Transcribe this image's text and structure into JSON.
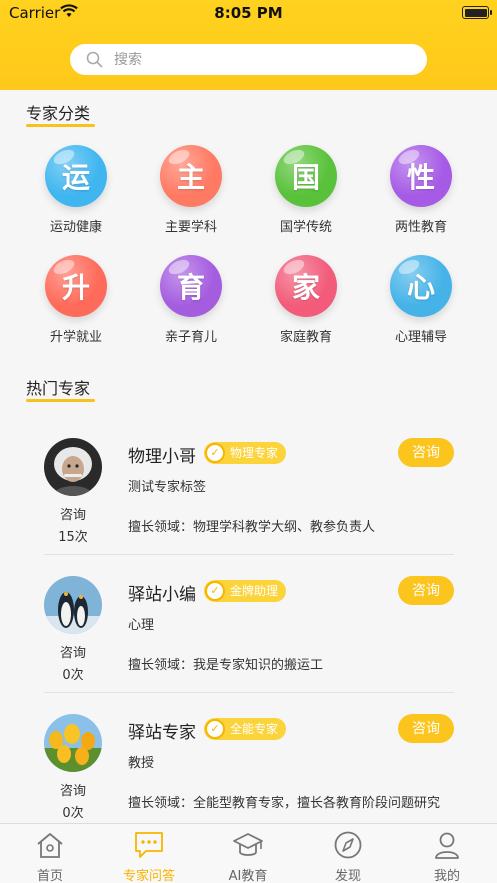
{
  "status_bar": {
    "carrier": "Carrier",
    "time": "8:05 PM"
  },
  "search": {
    "placeholder": "搜索"
  },
  "categories_section": {
    "title": "专家分类",
    "items": [
      {
        "label": "运动健康",
        "glyph": "运",
        "color": "#3fb6f0"
      },
      {
        "label": "主要学科",
        "glyph": "主",
        "color": "#ff7a63"
      },
      {
        "label": "国学传统",
        "glyph": "国",
        "color": "#59c23a"
      },
      {
        "label": "两性教育",
        "glyph": "性",
        "color": "#a65be6"
      },
      {
        "label": "升学就业",
        "glyph": "升",
        "color": "#ff6b5a"
      },
      {
        "label": "亲子育儿",
        "glyph": "育",
        "color": "#a55de0"
      },
      {
        "label": "家庭教育",
        "glyph": "家",
        "color": "#f25c7a"
      },
      {
        "label": "心理辅导",
        "glyph": "心",
        "color": "#45b3e8"
      }
    ]
  },
  "experts_section": {
    "title": "热门专家",
    "experts": [
      {
        "name": "物理小哥",
        "badge": "物理专家",
        "tag": "测试专家标签",
        "field": "擅长领域：物理学科教学大纲、教参负责人",
        "consult_label": "咨询",
        "count": "15次",
        "button": "咨询"
      },
      {
        "name": "驿站小编",
        "badge": "金牌助理",
        "tag": "心理",
        "field": "擅长领域：我是专家知识的搬运工",
        "consult_label": "咨询",
        "count": "0次",
        "button": "咨询"
      },
      {
        "name": "驿站专家",
        "badge": "全能专家",
        "tag": "教授",
        "field": "擅长领域：全能型教育专家，擅长各教育阶段问题研究",
        "consult_label": "咨询",
        "count": "0次",
        "button": "咨询"
      }
    ]
  },
  "tabbar": {
    "items": [
      {
        "label": "首页",
        "icon": "home-icon"
      },
      {
        "label": "专家问答",
        "icon": "chat-icon"
      },
      {
        "label": "AI教育",
        "icon": "graduation-cap-icon"
      },
      {
        "label": "发现",
        "icon": "compass-icon"
      },
      {
        "label": "我的",
        "icon": "user-icon"
      }
    ]
  }
}
